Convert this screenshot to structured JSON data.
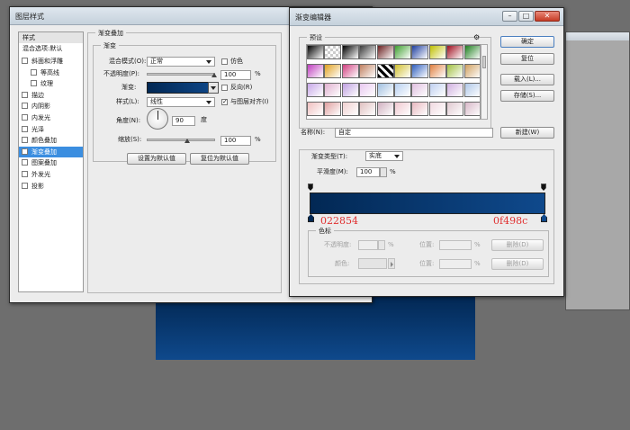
{
  "background_layer": {
    "color_top": "#022854",
    "color_bottom": "#0f498c"
  },
  "layer_style": {
    "title": "图层样式",
    "sidebar_header": "样式",
    "blend_options": "混合选项:默认",
    "items": [
      {
        "label": "斜面和浮雕",
        "checked": false,
        "sub": false
      },
      {
        "label": "等高线",
        "checked": false,
        "sub": true
      },
      {
        "label": "纹理",
        "checked": false,
        "sub": true
      },
      {
        "label": "描边",
        "checked": false,
        "sub": false
      },
      {
        "label": "内阴影",
        "checked": false,
        "sub": false
      },
      {
        "label": "内发光",
        "checked": false,
        "sub": false
      },
      {
        "label": "光泽",
        "checked": false,
        "sub": false
      },
      {
        "label": "颜色叠加",
        "checked": false,
        "sub": false
      },
      {
        "label": "渐变叠加",
        "checked": true,
        "sub": false,
        "selected": true
      },
      {
        "label": "图案叠加",
        "checked": false,
        "sub": false
      },
      {
        "label": "外发光",
        "checked": false,
        "sub": false
      },
      {
        "label": "投影",
        "checked": false,
        "sub": false
      }
    ],
    "section_title": "渐变叠加",
    "group_title": "渐变",
    "blend_mode_label": "混合模式(O):",
    "blend_mode_value": "正常",
    "dither_label": "仿色",
    "opacity_label": "不透明度(P):",
    "opacity_value": "100",
    "percent": "%",
    "gradient_label": "渐变:",
    "reverse_label": "反向(R)",
    "style_label": "样式(L):",
    "style_value": "线性",
    "align_label": "与图层对齐(I)",
    "angle_label": "角度(N):",
    "angle_value": "90",
    "degree": "度",
    "scale_label": "缩放(S):",
    "scale_value": "100",
    "set_default": "设置为默认值",
    "reset_default": "复位为默认值"
  },
  "gradient_editor": {
    "title": "渐变编辑器",
    "presets_label": "预设",
    "ok": "确定",
    "reset": "复位",
    "load": "载入(L)...",
    "save": "存储(S)...",
    "name_label": "名称(N):",
    "name_value": "自定",
    "new_button": "新建(W)",
    "type_label": "渐变类型(T):",
    "type_value": "实底",
    "smooth_label": "平滑度(M):",
    "smooth_value": "100",
    "percent": "%",
    "color_left": "022854",
    "color_right": "0f498c",
    "stops_group": "色标",
    "opacity_label": "不透明度:",
    "position_label": "位置:",
    "delete_label": "删除(D)",
    "color_label": "颜色:"
  },
  "presets": [
    [
      "#000000",
      "checker",
      "#000000",
      "#3a3a3a",
      "#6a2020",
      "#40a030",
      "#2040a0",
      "#c0c000",
      "#a01020",
      "#208020"
    ],
    [
      "#c040c0",
      "#e0a020",
      "#d04080",
      "#c08060",
      "stripe",
      "#d0c030",
      "#3060c0",
      "#e08040",
      "#a0c040",
      "#d0a060"
    ],
    [
      "#c8a8e8",
      "#e0b0d0",
      "#c0a0e0",
      "#e8c8f0",
      "#a0c0e0",
      "#b8d0f0",
      "#e0c0e0",
      "#c0d0f0",
      "#d0b0e0",
      "#b0c8e8"
    ],
    [
      "#f0c0c0",
      "#e0a0a0",
      "#f0d0d0",
      "#e0c0c0",
      "#d0b0c0",
      "#f0c8d0",
      "#e8b8c0",
      "#f0d8e0",
      "#e0c8d0",
      "#d8b8c8"
    ]
  ]
}
